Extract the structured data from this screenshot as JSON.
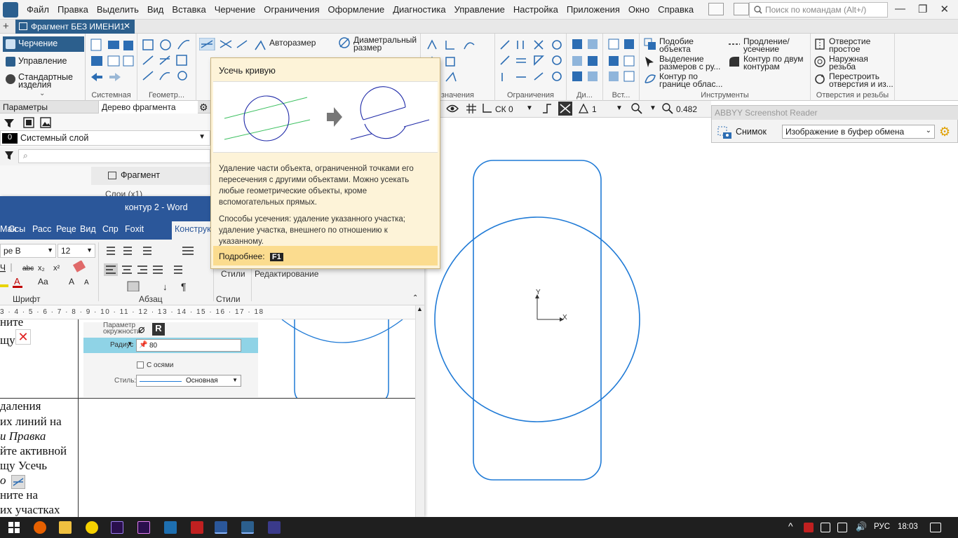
{
  "menubar": {
    "items": [
      "Файл",
      "Правка",
      "Выделить",
      "Вид",
      "Вставка",
      "Черчение",
      "Ограничения",
      "Оформление",
      "Диагностика",
      "Управление",
      "Настройка",
      "Приложения",
      "Окно",
      "Справка"
    ],
    "search_placeholder": "Поиск по командам (Alt+/)"
  },
  "doc_tab": {
    "label": "Фрагмент БЕЗ ИМЕНИ1"
  },
  "leftnav": {
    "items": [
      "Черчение",
      "Управление",
      "Стандартные изделия"
    ]
  },
  "ribbon": {
    "groups": [
      "Системная",
      "Геометр...",
      "Ограничения",
      "Ди...",
      "Вст...",
      "Инструменты",
      "Отверстия и резьбы"
    ],
    "autosize": "Авторазмер",
    "diam_size": "Диаметральный размер",
    "hidden_group": "значения",
    "tools": {
      "t1": "Подобие объекта",
      "t2": "Выделение размеров с ру...",
      "t3": "Контур по границе облас...",
      "t4": "Продление/ усечение",
      "t5": "Контур по двум контурам"
    },
    "holes": {
      "h1": "Отверстие простое",
      "h2": "Наружная резьба",
      "h3": "Перестроить отверстия и из..."
    }
  },
  "tooltip": {
    "title": "Усечь кривую",
    "desc1": "Удаление части объекта, ограниченной точками его пересечения с другими объектами. Можно усекать любые геометрические объекты, кроме вспомогательных прямых.",
    "desc2": "Способы усечения: удаление указанного участка; удаление участка, внешнего по отношению к указанному.",
    "more": "Подробнее:",
    "key": "F1"
  },
  "left_panel": {
    "tab1": "Параметры",
    "tab2": "Дерево фрагмента",
    "layer_num": "0",
    "layer_name": "Системный слой",
    "search_placeholder": "",
    "tree_item": "Фрагмент",
    "tree_sub": "Слои (x1)"
  },
  "word": {
    "title": "контур 2  -  Word",
    "tabs": [
      "Мак",
      "Ссы",
      "Расс",
      "Реце",
      "Вид",
      "Спр",
      "Foxit",
      "Конструк"
    ],
    "font_name": "ре В",
    "font_size": "12",
    "groups": [
      "Шрифт",
      "Абзац",
      "Стили",
      "Редактирование"
    ],
    "styles_label": "Стили",
    "edit_label": "Редактирование",
    "ruler": "3 · 4 · 5 · 6 · 7 · 8 · 9 · 10 · 11 · 12 · 13 · 14 · 15 · 16 · 17 · 18",
    "text_lines": [
      "ните",
      "щу",
      "даления",
      "их линий на",
      "и Правка",
      "йте активной",
      "щу Усечь",
      "о",
      "ните на",
      "их участках"
    ],
    "embed": {
      "param_label": "Параметр окружности:",
      "radius_label": "Радиус",
      "radius_value": "80",
      "axes_label": "С осями",
      "style_label": "Стиль:",
      "style_value": "Основная",
      "r_badge": "R"
    }
  },
  "drawbar": {
    "cs": "СК 0",
    "layer": "1",
    "zoom": "0.482"
  },
  "abbyy": {
    "title": "ABBYY Screenshot Reader",
    "snap_label": "Снимок",
    "target": "Изображение в буфер обмена"
  },
  "canvas": {
    "axis_x": "X",
    "axis_y": "Y"
  },
  "taskbar": {
    "lang": "РУС",
    "time": "18:03"
  }
}
